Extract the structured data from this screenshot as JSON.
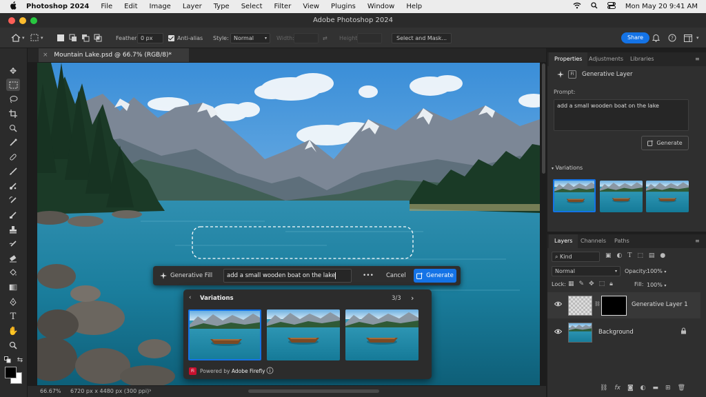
{
  "menubar": {
    "app": "Photoshop 2024",
    "items": [
      "File",
      "Edit",
      "Image",
      "Layer",
      "Type",
      "Select",
      "Filter",
      "View",
      "Plugins",
      "Window",
      "Help"
    ],
    "clock": "Mon May 20  9:41 AM"
  },
  "window_title": "Adobe Photoshop 2024",
  "options": {
    "feather_label": "Feather:",
    "feather_value": "0 px",
    "antialias_label": "Anti-alias",
    "style_label": "Style:",
    "style_value": "Normal",
    "width_label": "Width:",
    "height_label": "Height:",
    "select_mask": "Select and Mask...",
    "share": "Share"
  },
  "doc_tab": "Mountain Lake.psd @ 66.7% (RGB/8)*",
  "status": {
    "zoom": "66.67%",
    "doc_info": "6720 px x 4480 px (300 ppi)"
  },
  "gen_fill": {
    "label": "Generative Fill",
    "prompt": "add a small wooden boat on the lake",
    "more": "•••",
    "cancel": "Cancel",
    "generate": "Generate"
  },
  "variations_popup": {
    "title": "Variations",
    "count": "3/3",
    "powered_prefix": "Powered by",
    "powered_brand": "Adobe Firefly",
    "badge": "Fi"
  },
  "properties": {
    "tabs": [
      "Properties",
      "Adjustments",
      "Libraries"
    ],
    "layer_type": "Generative Layer",
    "badge": "Fi",
    "prompt_label": "Prompt:",
    "prompt_text": "add a small wooden boat on the lake",
    "generate": "Generate",
    "variations_label": "Variations"
  },
  "layers": {
    "tabs": [
      "Layers",
      "Channels",
      "Paths"
    ],
    "kind": "Kind",
    "blend_mode": "Normal",
    "opacity_label": "Opacity:",
    "opacity_value": "100%",
    "lock_label": "Lock:",
    "fill_label": "Fill:",
    "fill_value": "100%",
    "items": [
      {
        "name": "Generative Layer 1"
      },
      {
        "name": "Background"
      }
    ]
  },
  "colors": {
    "accent": "#1473e6",
    "panel_bg": "#2f2f2f",
    "app_bg": "#1e1e1e"
  }
}
